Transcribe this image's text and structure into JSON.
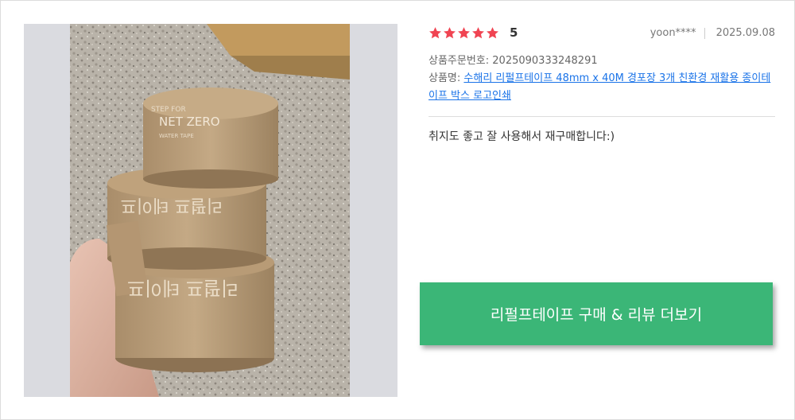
{
  "review": {
    "rating": 5,
    "rating_label": "5",
    "rating_fraction": 1.0,
    "star_color": "#f04452",
    "user": "yoon****",
    "date": "2025.09.08",
    "order_label": "상품주문번호:",
    "order_number": "2025090333248291",
    "product_label": "상품명:",
    "product_name": "수해리 리펄프테이프 48mm x 40M 경포장 3개 친환경 재활용 종이테이프 박스 로고인쇄",
    "text": "취지도 좋고 잘 사용해서 재구매합니다:)"
  },
  "photo": {
    "tape_print_top_1": "STEP FOR",
    "tape_print_top_2": "NET ZERO",
    "tape_print_small": "WATER TAPE",
    "tape_print_mid": "리펄프 테이프"
  },
  "cta": {
    "label": "리펄프테이프 구매 & 리뷰 더보기",
    "color": "#3bb677"
  }
}
